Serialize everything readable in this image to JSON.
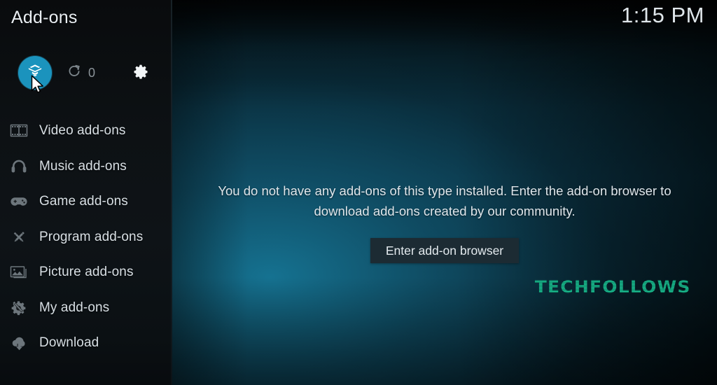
{
  "window": {
    "title": "Add-ons",
    "clock": "1:15 PM"
  },
  "toolbar": {
    "items": [
      {
        "name": "addon-browser",
        "icon": "package-box-icon",
        "label": "",
        "selected": true
      },
      {
        "name": "check-updates",
        "icon": "refresh-icon",
        "label": "0",
        "selected": false
      },
      {
        "name": "settings",
        "icon": "gear-icon",
        "label": "",
        "selected": false
      }
    ],
    "update_count": "0"
  },
  "sidebar": {
    "items": [
      {
        "label": "Video add-ons",
        "icon": "film-strip-icon"
      },
      {
        "label": "Music add-ons",
        "icon": "headphones-icon"
      },
      {
        "label": "Game add-ons",
        "icon": "gamepad-icon"
      },
      {
        "label": "Program add-ons",
        "icon": "pencil-wrench-icon"
      },
      {
        "label": "Picture add-ons",
        "icon": "photo-frame-icon"
      },
      {
        "label": "My add-ons",
        "icon": "gear-wrench-icon"
      },
      {
        "label": "Download",
        "icon": "cloud-download-icon"
      }
    ]
  },
  "main": {
    "empty_message": "You do not have any add-ons of this type installed. Enter the add-on browser to download add-ons created by our community.",
    "enter_browser_label": "Enter add-on browser"
  },
  "watermark": {
    "text": "TECHFOLLOWS"
  },
  "colors": {
    "accent": "#1b93bd",
    "sidebar_bg": "#0d1114",
    "main_bg": "#0a3040",
    "button_bg": "#1c2b33",
    "text": "#dfe6eb",
    "icon": "#5c676e",
    "watermark": "#1ec79a"
  }
}
